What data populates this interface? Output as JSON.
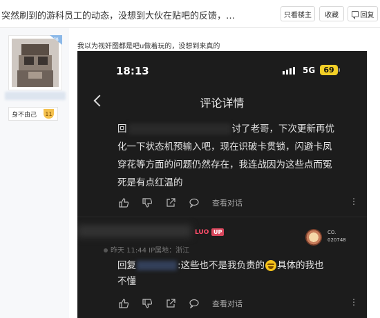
{
  "topbar": {
    "title": "突然刷到的游科员工的动态，没想到大伙在贴吧的反馈，…",
    "only_lz": "只看楼主",
    "favorite": "收藏",
    "reply": "回复"
  },
  "author": {
    "corner_badge": "楼",
    "level_name": "身不由己",
    "level_num": "11"
  },
  "post": {
    "caption": "我以为视奸图都是吧u做着玩的，没想到来真的"
  },
  "phone": {
    "status": {
      "time": "18:13",
      "network": "5G",
      "battery": "69"
    },
    "header_title": "评论详情",
    "comment1": {
      "l1_start": "回",
      "l1_end": "讨了老哥，下次更新再优",
      "l2": "化一下状态机预输入吧，现在识破卡贯锁，闪避卡凤",
      "l3": "穿花等方面的问题仍然存在，我连战因为这些点而冤",
      "l4": "死是有点红温的",
      "view_thread": "查看对话"
    },
    "reply_user": {
      "tag_luo": "LUO",
      "tag_up": "UP",
      "meta": "昨天 11:44 IP属地：浙江",
      "fan_line1": "CO.",
      "fan_line2": "020748"
    },
    "comment2": {
      "prefix": "回复",
      "text1": ":这些也不是我负责的",
      "text2": "具体的我也",
      "text3": "不懂",
      "view_thread": "查看对话"
    }
  }
}
